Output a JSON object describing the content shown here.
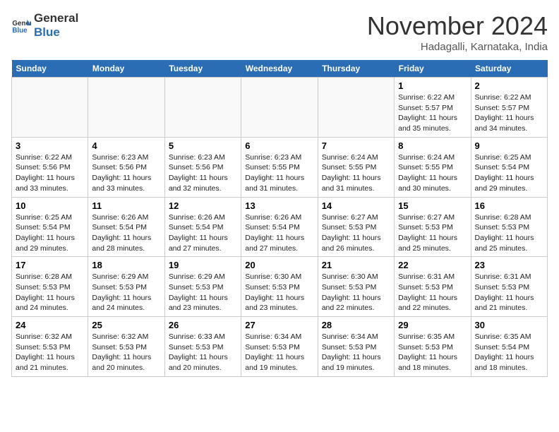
{
  "header": {
    "logo_line1": "General",
    "logo_line2": "Blue",
    "month": "November 2024",
    "location": "Hadagalli, Karnataka, India"
  },
  "weekdays": [
    "Sunday",
    "Monday",
    "Tuesday",
    "Wednesday",
    "Thursday",
    "Friday",
    "Saturday"
  ],
  "weeks": [
    [
      {
        "day": "",
        "info": ""
      },
      {
        "day": "",
        "info": ""
      },
      {
        "day": "",
        "info": ""
      },
      {
        "day": "",
        "info": ""
      },
      {
        "day": "",
        "info": ""
      },
      {
        "day": "1",
        "info": "Sunrise: 6:22 AM\nSunset: 5:57 PM\nDaylight: 11 hours\nand 35 minutes."
      },
      {
        "day": "2",
        "info": "Sunrise: 6:22 AM\nSunset: 5:57 PM\nDaylight: 11 hours\nand 34 minutes."
      }
    ],
    [
      {
        "day": "3",
        "info": "Sunrise: 6:22 AM\nSunset: 5:56 PM\nDaylight: 11 hours\nand 33 minutes."
      },
      {
        "day": "4",
        "info": "Sunrise: 6:23 AM\nSunset: 5:56 PM\nDaylight: 11 hours\nand 33 minutes."
      },
      {
        "day": "5",
        "info": "Sunrise: 6:23 AM\nSunset: 5:56 PM\nDaylight: 11 hours\nand 32 minutes."
      },
      {
        "day": "6",
        "info": "Sunrise: 6:23 AM\nSunset: 5:55 PM\nDaylight: 11 hours\nand 31 minutes."
      },
      {
        "day": "7",
        "info": "Sunrise: 6:24 AM\nSunset: 5:55 PM\nDaylight: 11 hours\nand 31 minutes."
      },
      {
        "day": "8",
        "info": "Sunrise: 6:24 AM\nSunset: 5:55 PM\nDaylight: 11 hours\nand 30 minutes."
      },
      {
        "day": "9",
        "info": "Sunrise: 6:25 AM\nSunset: 5:54 PM\nDaylight: 11 hours\nand 29 minutes."
      }
    ],
    [
      {
        "day": "10",
        "info": "Sunrise: 6:25 AM\nSunset: 5:54 PM\nDaylight: 11 hours\nand 29 minutes."
      },
      {
        "day": "11",
        "info": "Sunrise: 6:26 AM\nSunset: 5:54 PM\nDaylight: 11 hours\nand 28 minutes."
      },
      {
        "day": "12",
        "info": "Sunrise: 6:26 AM\nSunset: 5:54 PM\nDaylight: 11 hours\nand 27 minutes."
      },
      {
        "day": "13",
        "info": "Sunrise: 6:26 AM\nSunset: 5:54 PM\nDaylight: 11 hours\nand 27 minutes."
      },
      {
        "day": "14",
        "info": "Sunrise: 6:27 AM\nSunset: 5:53 PM\nDaylight: 11 hours\nand 26 minutes."
      },
      {
        "day": "15",
        "info": "Sunrise: 6:27 AM\nSunset: 5:53 PM\nDaylight: 11 hours\nand 25 minutes."
      },
      {
        "day": "16",
        "info": "Sunrise: 6:28 AM\nSunset: 5:53 PM\nDaylight: 11 hours\nand 25 minutes."
      }
    ],
    [
      {
        "day": "17",
        "info": "Sunrise: 6:28 AM\nSunset: 5:53 PM\nDaylight: 11 hours\nand 24 minutes."
      },
      {
        "day": "18",
        "info": "Sunrise: 6:29 AM\nSunset: 5:53 PM\nDaylight: 11 hours\nand 24 minutes."
      },
      {
        "day": "19",
        "info": "Sunrise: 6:29 AM\nSunset: 5:53 PM\nDaylight: 11 hours\nand 23 minutes."
      },
      {
        "day": "20",
        "info": "Sunrise: 6:30 AM\nSunset: 5:53 PM\nDaylight: 11 hours\nand 23 minutes."
      },
      {
        "day": "21",
        "info": "Sunrise: 6:30 AM\nSunset: 5:53 PM\nDaylight: 11 hours\nand 22 minutes."
      },
      {
        "day": "22",
        "info": "Sunrise: 6:31 AM\nSunset: 5:53 PM\nDaylight: 11 hours\nand 22 minutes."
      },
      {
        "day": "23",
        "info": "Sunrise: 6:31 AM\nSunset: 5:53 PM\nDaylight: 11 hours\nand 21 minutes."
      }
    ],
    [
      {
        "day": "24",
        "info": "Sunrise: 6:32 AM\nSunset: 5:53 PM\nDaylight: 11 hours\nand 21 minutes."
      },
      {
        "day": "25",
        "info": "Sunrise: 6:32 AM\nSunset: 5:53 PM\nDaylight: 11 hours\nand 20 minutes."
      },
      {
        "day": "26",
        "info": "Sunrise: 6:33 AM\nSunset: 5:53 PM\nDaylight: 11 hours\nand 20 minutes."
      },
      {
        "day": "27",
        "info": "Sunrise: 6:34 AM\nSunset: 5:53 PM\nDaylight: 11 hours\nand 19 minutes."
      },
      {
        "day": "28",
        "info": "Sunrise: 6:34 AM\nSunset: 5:53 PM\nDaylight: 11 hours\nand 19 minutes."
      },
      {
        "day": "29",
        "info": "Sunrise: 6:35 AM\nSunset: 5:53 PM\nDaylight: 11 hours\nand 18 minutes."
      },
      {
        "day": "30",
        "info": "Sunrise: 6:35 AM\nSunset: 5:54 PM\nDaylight: 11 hours\nand 18 minutes."
      }
    ]
  ]
}
